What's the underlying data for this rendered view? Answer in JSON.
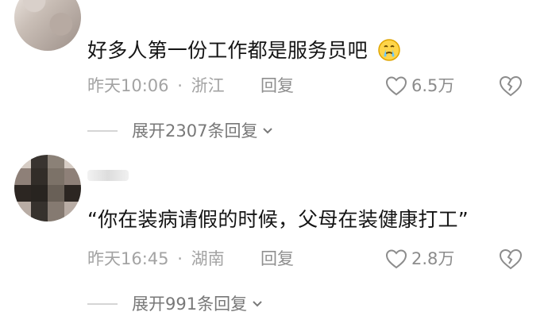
{
  "comments": [
    {
      "text": "好多人第一份工作都是服务员吧",
      "emoji": "crying-face",
      "time": "昨天10:06",
      "location": "浙江",
      "separator": "·",
      "reply": "回复",
      "likes": "6.5万",
      "expand": "展开2307条回复"
    },
    {
      "author": "",
      "text": "“你在装病请假的时候，父母在装健康打工”",
      "time": "昨天16:45",
      "location": "湖南",
      "separator": "·",
      "reply": "回复",
      "likes": "2.8万",
      "expand": "展开991条回复"
    }
  ],
  "colors": {
    "text": "#151515",
    "meta": "#a3a3a3",
    "secondary": "#8c8c8c",
    "divider": "#d5d5d5"
  }
}
